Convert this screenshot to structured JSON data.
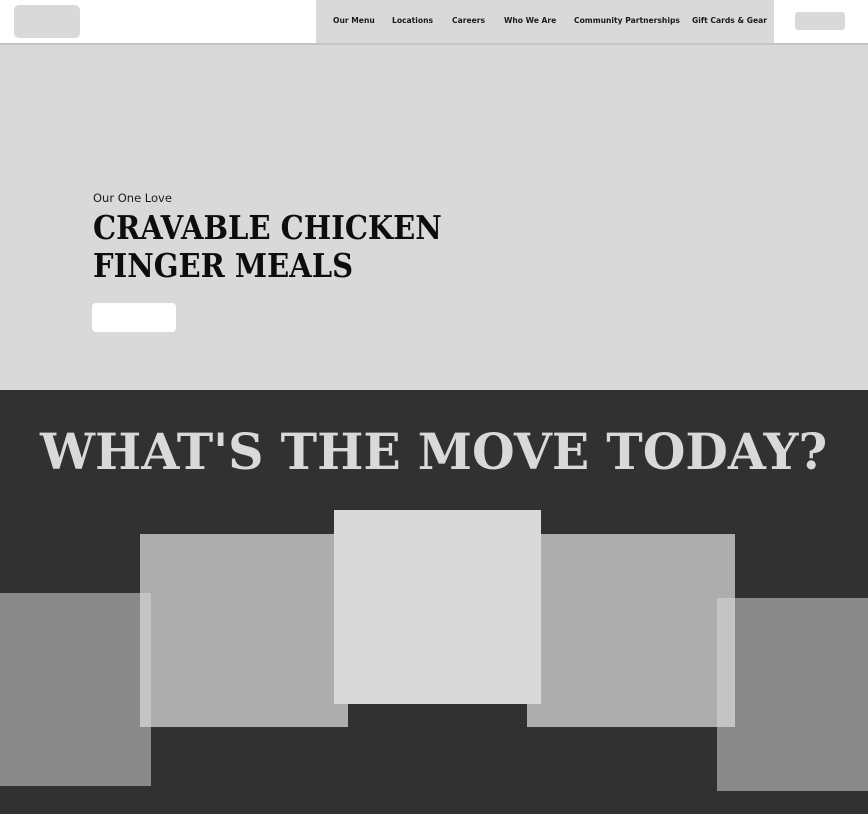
{
  "nav": {
    "items": [
      {
        "label": "Our Menu"
      },
      {
        "label": "Locations"
      },
      {
        "label": "Careers"
      },
      {
        "label": "Who We Are"
      },
      {
        "label": "Community Partnerships"
      },
      {
        "label": "Gift Cards & Gear"
      }
    ]
  },
  "hero": {
    "eyebrow": "Our One Love",
    "title_line1": "CRAVABLE CHICKEN",
    "title_line2": "FINGER MEALS"
  },
  "move": {
    "heading": "WHAT'S THE MOVE TODAY?"
  },
  "colors": {
    "dark_section": "#313131",
    "placeholder_light": "#d9d9d9",
    "placeholder_mid": "#adadad",
    "placeholder_dark": "#8a8a8a"
  }
}
